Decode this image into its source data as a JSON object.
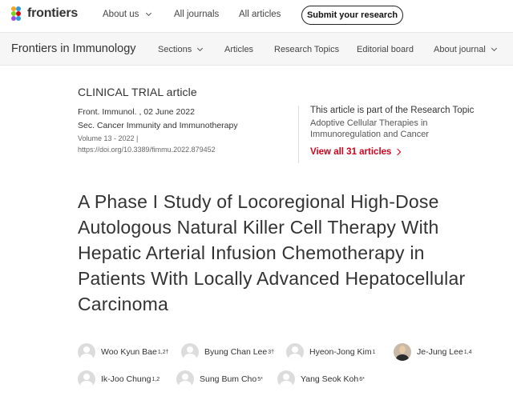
{
  "header": {
    "logo_text": "frontiers",
    "nav": [
      {
        "label": "About us",
        "has_dropdown": true
      },
      {
        "label": "All journals",
        "has_dropdown": false
      },
      {
        "label": "All articles",
        "has_dropdown": false
      }
    ],
    "submit_label": "Submit your research"
  },
  "journal_bar": {
    "journal_name": "Frontiers in Immunology",
    "nav": [
      {
        "label": "Sections",
        "has_dropdown": true
      },
      {
        "label": "Articles",
        "has_dropdown": false
      },
      {
        "label": "Research Topics",
        "has_dropdown": false
      },
      {
        "label": "Editorial board",
        "has_dropdown": false
      },
      {
        "label": "About journal",
        "has_dropdown": true
      }
    ]
  },
  "article": {
    "type": "CLINICAL TRIAL article",
    "citation": "Front. Immunol. , 02 June 2022",
    "section": "Sec. Cancer Immunity and Immunotherapy",
    "volume": "Volume 13 - 2022 |",
    "doi": "https://doi.org/10.3389/fimmu.2022.879452",
    "title": "A Phase I Study of Locoregional High-Dose Autologous Natural Killer Cell Therapy With Hepatic Arterial Infusion Chemotherapy in Patients With Locally Advanced Hepatocellular Carcinoma"
  },
  "research_topic": {
    "heading": "This article is part of the Research Topic",
    "name": "Adoptive Cellular Therapies in Immunoregulation and Cancer",
    "link": "View all 31 articles"
  },
  "authors": [
    {
      "name": "Woo Kyun Bae",
      "affil": "1,2†",
      "photo": false
    },
    {
      "name": "Byung Chan Lee",
      "affil": "3†",
      "photo": false
    },
    {
      "name": "Hyeon-Jong Kim",
      "affil": "1",
      "photo": false
    },
    {
      "name": "Je-Jung Lee",
      "affil": "1,4",
      "photo": true
    },
    {
      "name": "Ik-Joo Chung",
      "affil": "1,2",
      "photo": false
    },
    {
      "name": "Sung Bum Cho",
      "affil": "5*",
      "photo": false
    },
    {
      "name": "Yang Seok Koh",
      "affil": "6*",
      "photo": false
    }
  ],
  "colors": {
    "accent_red": "#d0021b",
    "text": "#333333",
    "journal_bar_bg": "#f6f6f6"
  }
}
